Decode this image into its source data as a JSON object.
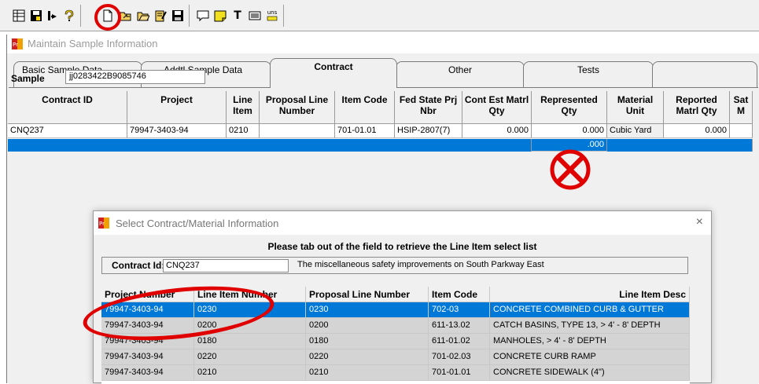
{
  "toolbar": {
    "icons": [
      "grid-icon",
      "save-disk-icon",
      "download-icon",
      "help-icon",
      "new-doc-icon",
      "open-folder-icon",
      "open-folder-2-icon",
      "edit-doc-icon",
      "floppy-icon",
      "comment-icon",
      "note-icon",
      "text-icon",
      "list-icon",
      "units-icon"
    ],
    "units_label": "uns"
  },
  "window": {
    "title": "Maintain Sample Information",
    "logo_text": "PrS"
  },
  "tabs": [
    {
      "label": "Basic Sample Data"
    },
    {
      "label": "Addtl Sample Data"
    },
    {
      "label": "Contract"
    },
    {
      "label": "Other"
    },
    {
      "label": "Tests"
    }
  ],
  "sample": {
    "label": "Sample",
    "value": "jj0283422B9085746"
  },
  "contract_grid": {
    "headers": [
      "Contract ID",
      "Project",
      "Line Item",
      "Proposal Line Number",
      "Item Code",
      "Fed State Prj Nbr",
      "Cont Est Matrl Qty",
      "Represented Qty",
      "Material Unit",
      "Reported Matrl Qty",
      "Sat M"
    ],
    "row1": [
      "CNQ237",
      "79947-3403-94",
      "0210",
      "",
      "701-01.01",
      "HSIP-2807(7)",
      "0.000",
      "0.000",
      "Cubic Yard",
      "0.000",
      ""
    ],
    "row2_partial": ".000"
  },
  "dialog": {
    "title": "Select Contract/Material Information",
    "close": "×",
    "message": "Please tab out of the field to retrieve the Line Item select list",
    "contract_label": "Contract Id:",
    "contract_value": "CNQ237",
    "contract_desc": "The miscellaneous safety improvements on South Parkway East",
    "columns": [
      "Project Number",
      "Line Item Number",
      "Proposal Line Number",
      "Item Code",
      "Line Item Desc"
    ],
    "rows": [
      [
        "79947-3403-94",
        "0230",
        "0230",
        "702-03",
        "CONCRETE COMBINED CURB & GUTTER"
      ],
      [
        "79947-3403-94",
        "0200",
        "0200",
        "611-13.02",
        "CATCH BASINS, TYPE 13, > 4' - 8' DEPTH"
      ],
      [
        "79947-3403-94",
        "0180",
        "0180",
        "611-01.02",
        "MANHOLES, > 4' - 8' DEPTH"
      ],
      [
        "79947-3403-94",
        "0220",
        "0220",
        "701-02.03",
        "CONCRETE CURB RAMP"
      ],
      [
        "79947-3403-94",
        "0210",
        "0210",
        "701-01.01",
        "CONCRETE SIDEWALK (4\")"
      ]
    ]
  },
  "colors": {
    "selection": "#0078d7",
    "annotation": "#e00000"
  }
}
